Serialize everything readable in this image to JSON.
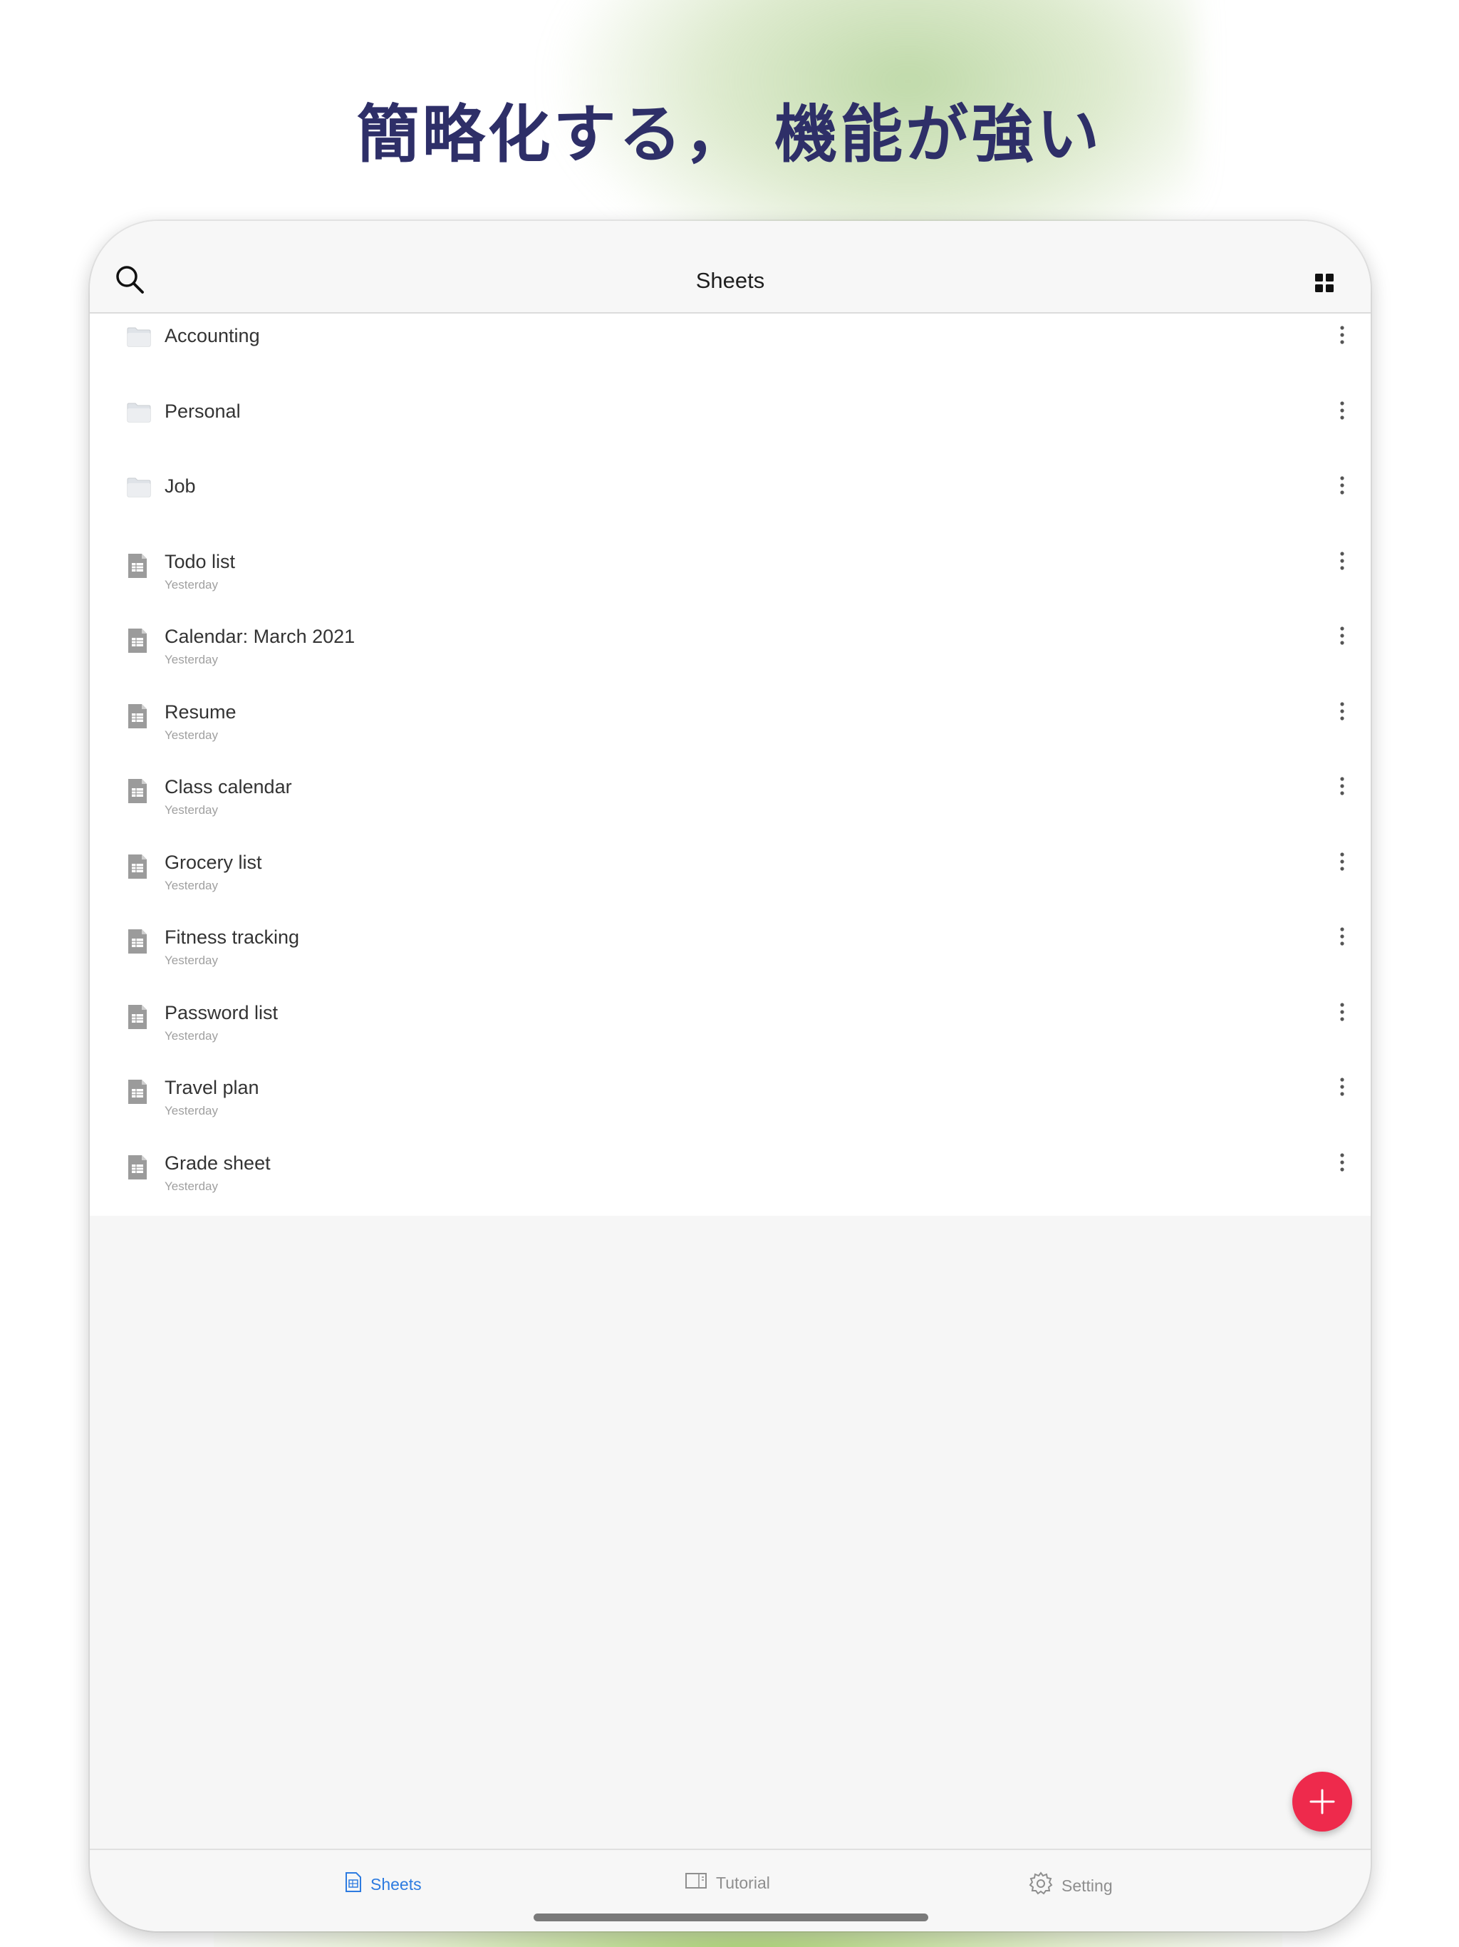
{
  "headline": "簡略化する， 機能が強い",
  "colors": {
    "headline": "#2e2f68",
    "accent": "#2d7be0",
    "fab": "#ee2a4c",
    "glow": "#b7d79a"
  },
  "nav": {
    "title": "Sheets",
    "search_icon": "search-icon",
    "view_icon": "grid-view-icon"
  },
  "folders": [
    {
      "name": "Accounting",
      "icon": "folder-icon"
    },
    {
      "name": "Personal",
      "icon": "folder-icon"
    },
    {
      "name": "Job",
      "icon": "folder-icon"
    }
  ],
  "files": [
    {
      "name": "Todo list",
      "date": "Yesterday",
      "icon": "spreadsheet-file-icon"
    },
    {
      "name": "Calendar: March 2021",
      "date": "Yesterday",
      "icon": "spreadsheet-file-icon"
    },
    {
      "name": "Resume",
      "date": "Yesterday",
      "icon": "spreadsheet-file-icon"
    },
    {
      "name": "Class calendar",
      "date": "Yesterday",
      "icon": "spreadsheet-file-icon"
    },
    {
      "name": "Grocery list",
      "date": "Yesterday",
      "icon": "spreadsheet-file-icon"
    },
    {
      "name": "Fitness tracking",
      "date": "Yesterday",
      "icon": "spreadsheet-file-icon"
    },
    {
      "name": "Password list",
      "date": "Yesterday",
      "icon": "spreadsheet-file-icon"
    },
    {
      "name": "Travel plan",
      "date": "Yesterday",
      "icon": "spreadsheet-file-icon"
    },
    {
      "name": "Grade sheet",
      "date": "Yesterday",
      "icon": "spreadsheet-file-icon"
    }
  ],
  "fab_icon": "plus-icon",
  "tabs": [
    {
      "label": "Sheets",
      "icon": "sheets-icon",
      "active": true
    },
    {
      "label": "Tutorial",
      "icon": "tutorial-icon",
      "active": false
    },
    {
      "label": "Setting",
      "icon": "gear-icon",
      "active": false
    }
  ]
}
